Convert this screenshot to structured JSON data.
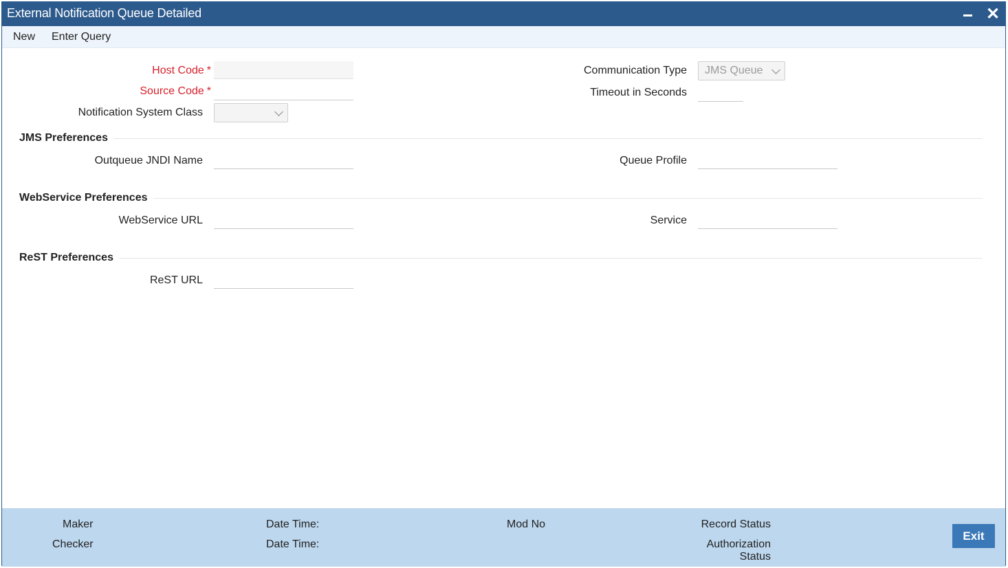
{
  "window": {
    "title": "External Notification Queue Detailed",
    "minimize_icon": "minimize-icon",
    "close_icon": "close-icon",
    "close_glyph": "✕"
  },
  "toolbar": {
    "new_label": "New",
    "enter_query_label": "Enter Query"
  },
  "form": {
    "host_code_label": "Host Code",
    "source_code_label": "Source Code",
    "required_marker": "*",
    "notification_system_class_label": "Notification System Class",
    "notification_system_class_value": "",
    "communication_type_label": "Communication Type",
    "communication_type_value": "JMS Queue",
    "timeout_label": "Timeout in Seconds"
  },
  "jms": {
    "heading": "JMS Preferences",
    "outqueue_label": "Outqueue JNDI Name",
    "queue_profile_label": "Queue Profile"
  },
  "webservice": {
    "heading": "WebService Preferences",
    "url_label": "WebService URL",
    "service_label": "Service"
  },
  "rest": {
    "heading": "ReST Preferences",
    "url_label": "ReST URL"
  },
  "footer": {
    "maker_label": "Maker",
    "checker_label": "Checker",
    "date_time_label_1": "Date Time:",
    "date_time_label_2": "Date Time:",
    "mod_no_label": "Mod No",
    "record_status_label": "Record Status",
    "authorization_status_line1": "Authorization",
    "authorization_status_line2": "Status",
    "exit_label": "Exit"
  },
  "colors": {
    "titlebar": "#2c5a8c",
    "required_label": "#d6202a",
    "footer_bg": "#bdd7ee",
    "exit_button": "#3a78b8"
  }
}
